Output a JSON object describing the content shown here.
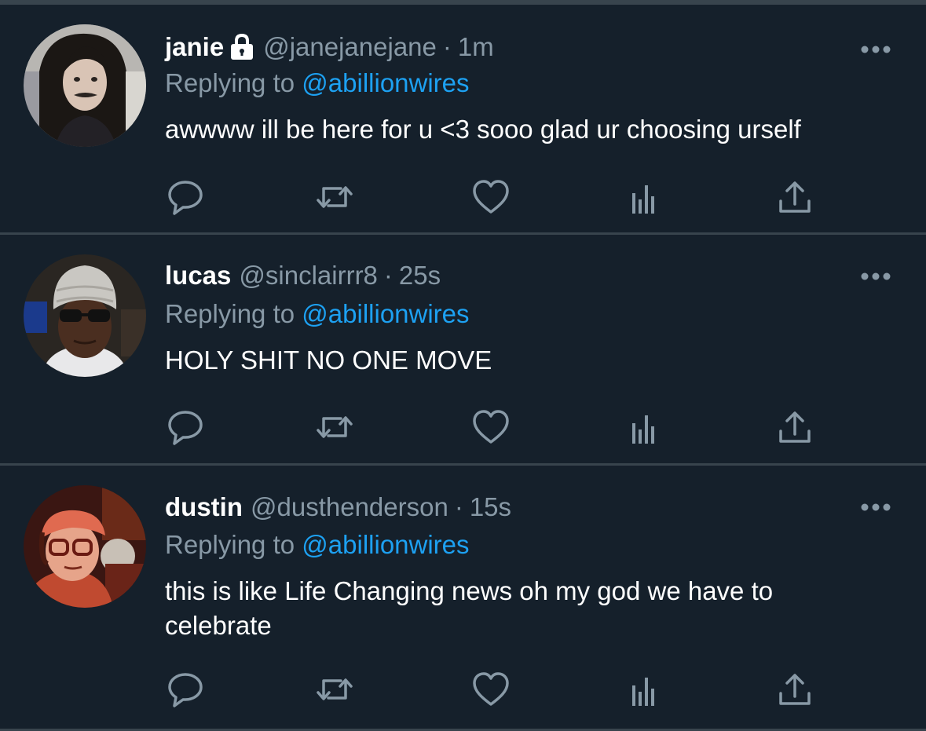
{
  "colors": {
    "background": "#15202b",
    "divider": "#38444d",
    "primary_text": "#ffffff",
    "secondary_text": "#8899a6",
    "link": "#1da1f2"
  },
  "tweets": [
    {
      "display_name": "janie",
      "protected": true,
      "handle": "@janejanejane",
      "separator": "·",
      "time": "1m",
      "replying_label": "Replying to",
      "replying_to": "@abillionwires",
      "text": "awwww ill be here for u <3 sooo glad ur choosing urself",
      "icons": [
        "avatar",
        "lock-icon",
        "more-icon",
        "reply-icon",
        "retweet-icon",
        "like-icon",
        "analytics-icon",
        "share-icon"
      ]
    },
    {
      "display_name": "lucas",
      "protected": false,
      "handle": "@sinclairrr8",
      "separator": "·",
      "time": "25s",
      "replying_label": "Replying to",
      "replying_to": "@abillionwires",
      "text": "HOLY SHIT NO ONE MOVE",
      "icons": [
        "avatar",
        "more-icon",
        "reply-icon",
        "retweet-icon",
        "like-icon",
        "analytics-icon",
        "share-icon"
      ]
    },
    {
      "display_name": "dustin",
      "protected": false,
      "handle": "@dusthenderson",
      "separator": "·",
      "time": "15s",
      "replying_label": "Replying to",
      "replying_to": "@abillionwires",
      "text": "this is like Life Changing news oh my god we have to celebrate",
      "icons": [
        "avatar",
        "more-icon",
        "reply-icon",
        "retweet-icon",
        "like-icon",
        "analytics-icon",
        "share-icon"
      ]
    }
  ]
}
